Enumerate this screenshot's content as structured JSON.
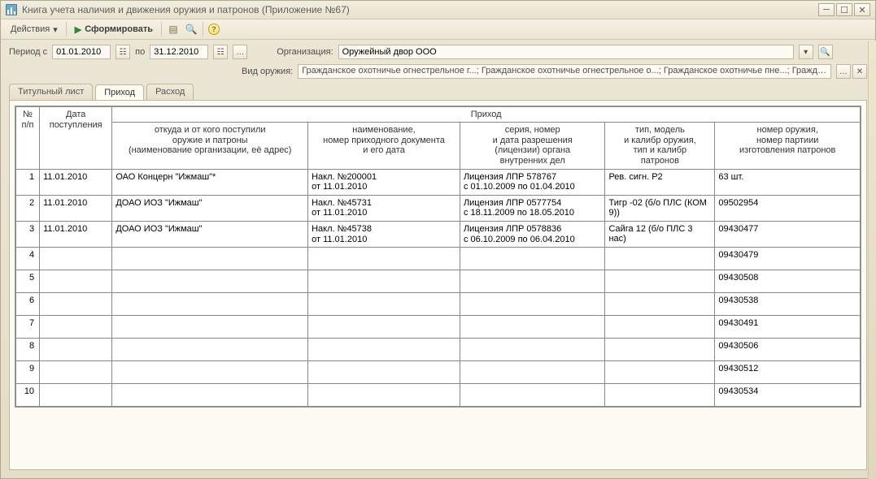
{
  "window": {
    "title": "Книга учета наличия и движения оружия и патронов (Приложение №67)"
  },
  "toolbar": {
    "actions_label": "Действия",
    "form_label": "Сформировать"
  },
  "filters": {
    "period_label": "Период с",
    "date_from": "01.01.2010",
    "period_to_label": "по",
    "date_to": "31.12.2010",
    "org_label": "Организация:",
    "org_value": "Оружейный двор ООО",
    "kind_label": "Вид оружия:",
    "kind_value": "Гражданское охотничье огнестрельное г...; Гражданское охотничье огнестрельное о...; Гражданское охотничье пне...; Гражданс"
  },
  "tabs": [
    {
      "label": "Титульный лист"
    },
    {
      "label": "Приход"
    },
    {
      "label": "Расход"
    }
  ],
  "active_tab": 1,
  "table": {
    "merge_title": "Приход",
    "headers": {
      "num": "№\nп/п",
      "date": "Дата\nпоступления",
      "from": "откуда и от кого поступили\nоружие и патроны\n(наименование организации, её адрес)",
      "doc": "наименование,\nномер приходного документа\nи его дата",
      "lic": "серия, номер\nи дата разрешения\n(лицензии) органа\nвнутренних дел",
      "type": "тип, модель\nи калибр оружия,\nтип и калибр\nпатронов",
      "weap": "номер оружия,\nномер партиии\nизготовления патронов"
    },
    "rows": [
      {
        "n": "1",
        "date": "11.01.2010",
        "from": "ОАО Концерн \"Ижмаш\"*",
        "doc": "Накл. №200001\nот 11.01.2010",
        "lic": "Лицензия ЛПР 578767\nс 01.10.2009 по 01.04.2010",
        "type": "Рев. сигн. Р2",
        "weap": "63 шт."
      },
      {
        "n": "2",
        "date": "11.01.2010",
        "from": "ДОАО ИОЗ \"Ижмаш\"",
        "doc": "Накл. №45731\nот 11.01.2010",
        "lic": "Лицензия ЛПР 0577754\nс 18.11.2009 по 18.05.2010",
        "type": "Тигр -02 (б/о ПЛС (КОМ 9))",
        "weap": "09502954"
      },
      {
        "n": "3",
        "date": "11.01.2010",
        "from": "ДОАО ИОЗ \"Ижмаш\"",
        "doc": "Накл. №45738\nот 11.01.2010",
        "lic": "Лицензия ЛПР 0578836\nс 06.10.2009 по 06.04.2010",
        "type": "Сайга 12 (б/о ПЛС 3 нас)",
        "weap": "09430477"
      },
      {
        "n": "4",
        "date": "",
        "from": "",
        "doc": "",
        "lic": "",
        "type": "",
        "weap": "09430479"
      },
      {
        "n": "5",
        "date": "",
        "from": "",
        "doc": "",
        "lic": "",
        "type": "",
        "weap": "09430508"
      },
      {
        "n": "6",
        "date": "",
        "from": "",
        "doc": "",
        "lic": "",
        "type": "",
        "weap": "09430538"
      },
      {
        "n": "7",
        "date": "",
        "from": "",
        "doc": "",
        "lic": "",
        "type": "",
        "weap": "09430491"
      },
      {
        "n": "8",
        "date": "",
        "from": "",
        "doc": "",
        "lic": "",
        "type": "",
        "weap": "09430506"
      },
      {
        "n": "9",
        "date": "",
        "from": "",
        "doc": "",
        "lic": "",
        "type": "",
        "weap": "09430512"
      },
      {
        "n": "10",
        "date": "",
        "from": "",
        "doc": "",
        "lic": "",
        "type": "",
        "weap": "09430534"
      }
    ]
  }
}
